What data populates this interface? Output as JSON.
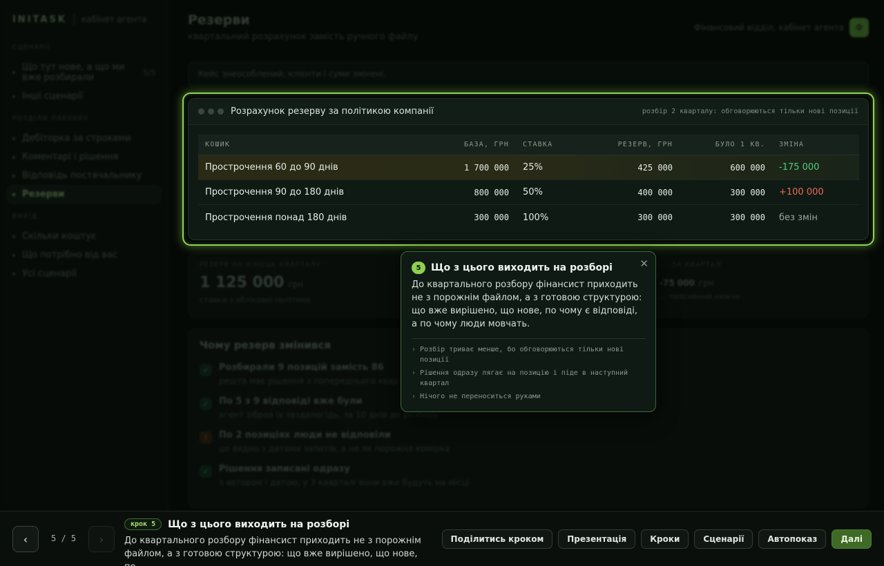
{
  "sidebar": {
    "brand": "INITASK",
    "brand_sub": "кабінет агента",
    "sections": [
      {
        "title": "СЦЕНАРІЇ",
        "items": [
          {
            "label": "Що тут нове, а що ми вже розбирали",
            "count": "5/5"
          },
          {
            "label": "Інші сценарії"
          }
        ]
      },
      {
        "title": "РОЗДІЛИ ПАКУНКУ",
        "items": [
          {
            "label": "Дебіторка за строками"
          },
          {
            "label": "Коментарі і рішення"
          },
          {
            "label": "Відповідь постачальнику"
          },
          {
            "label": "Резерви",
            "active": true
          }
        ]
      },
      {
        "title": "ВИХІД",
        "items": [
          {
            "label": "Скільки коштує"
          },
          {
            "label": "Що потрібно від вас"
          },
          {
            "label": "Усі сценарії"
          }
        ]
      }
    ]
  },
  "header": {
    "title": "Резерви",
    "subtitle": "квартальний розрахунок замість ручного файлу",
    "right_label": "Фінансовий відділ, кабінет агента",
    "avatar": "Ф"
  },
  "note_bar": "Кейс знеособлений, клієнти і суми змінені.",
  "table_card": {
    "title": "Розрахунок резерву за політикою компанії",
    "note": "розбір 2 кварталу: обговорюються тільки нові позиції",
    "columns": [
      "КОШИК",
      "БАЗА, ГРН",
      "СТАВКА",
      "РЕЗЕРВ, ГРН",
      "БУЛО 1 КВ.",
      "ЗМІНА"
    ],
    "rows": [
      {
        "basket": "Прострочення 60 до 90 днів",
        "base": "1 700 000",
        "rate": "25%",
        "reserve": "425 000",
        "prev": "600 000",
        "change": "-175 000",
        "change_type": "neg",
        "highlight": true
      },
      {
        "basket": "Прострочення 90 до 180 днів",
        "base": "800 000",
        "rate": "50%",
        "reserve": "400 000",
        "prev": "300 000",
        "change": "+100 000",
        "change_type": "pos"
      },
      {
        "basket": "Прострочення понад 180 днів",
        "base": "300 000",
        "rate": "100%",
        "reserve": "300 000",
        "prev": "300 000",
        "change": "без змін",
        "change_type": "same"
      }
    ]
  },
  "stats": {
    "left_label": "РЕЗЕРВ НА КІНЕЦЬ КВАРТАЛУ",
    "left_value": "1 125 000",
    "left_unit": "грн",
    "left_note": "ставки з облікової політики",
    "right_label": "... ЗА КВАРТАЛ",
    "right_value": "-75 000",
    "right_unit": "грн",
    "right_note": "... пояснення нижче"
  },
  "why": {
    "title": "Чому резерв змінився",
    "items": [
      {
        "head": "Розбирали 9 позицій замість 86",
        "sub": "решта має рішення з попереднього кварталу",
        "icon": "check"
      },
      {
        "head": "По 5 з 9 відповіді вже були",
        "sub": "агент зібрав їх заздалегідь, за 10 днів до розбору",
        "icon": "check"
      },
      {
        "head": "По 2 позиціях люди не відповіли",
        "sub": "це видно з датами запитів, а не як порожня комірка",
        "icon": "warn"
      },
      {
        "head": "Рішення записані одразу",
        "sub": "з автором і датою, у 3 кварталі вони вже будуть на місці",
        "icon": "check"
      }
    ]
  },
  "popover": {
    "num": "5",
    "title": "Що з цього виходить на розборі",
    "body": "До квартального розбору фінансист приходить не з порожнім файлом, а з готовою структурою: що вже вирішено, що нове, по чому є відповіді, а по чому люди мовчать.",
    "bullets": [
      "Розбір триває менше, бо обговорюються тільки нові позиції",
      "Рішення одразу лягає на позицію і піде в наступний квартал",
      "Нічого не переноситься руками"
    ],
    "close": "✕"
  },
  "bottom": {
    "prev": "‹",
    "next": "›",
    "counter": "5 / 5",
    "step_tag": "крок 5",
    "step_title": "Що з цього виходить на розборі",
    "step_desc": "До квартального розбору фінансист приходить не з порожнім файлом, а з готовою структурою: що вже вирішено, що нове, по…",
    "actions": [
      "Поділитись кроком",
      "Презентація",
      "Кроки",
      "Сценарії",
      "Автопоказ",
      "Далі"
    ]
  },
  "colors": {
    "accent": "#8fd450",
    "negative_change": "#4fcf7c",
    "positive_change": "#e86a5a"
  }
}
